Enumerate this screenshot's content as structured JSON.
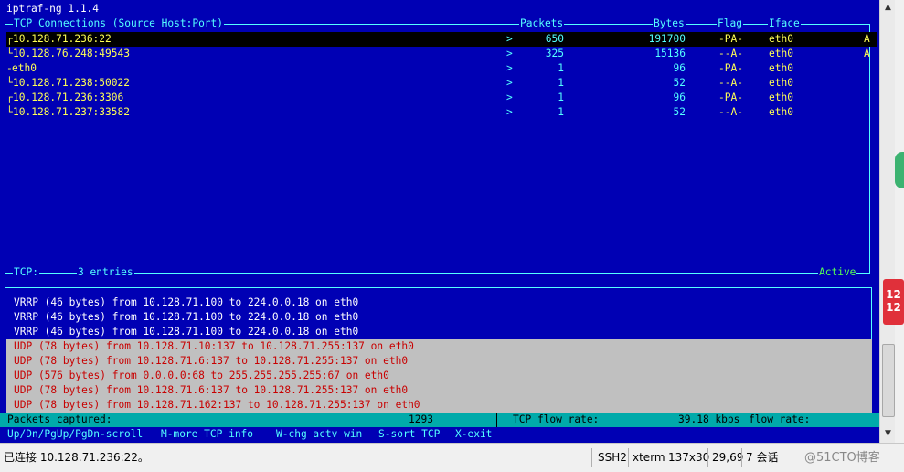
{
  "app": {
    "title": "iptraf-ng 1.1.4"
  },
  "tcp_panel": {
    "header": {
      "conn": "TCP Connections (Source Host:Port)",
      "packets": "Packets",
      "bytes": "Bytes",
      "flag": "Flag",
      "iface": "Iface"
    },
    "rows": [
      {
        "prefix": "┌",
        "host": "10.128.71.236:22",
        "arrow": ">",
        "packets": "650",
        "bytes": "191700",
        "flag": "-PA-",
        "iface": "eth0",
        "state": "A",
        "selected": true
      },
      {
        "prefix": "└",
        "host": "10.128.76.248:49543",
        "arrow": ">",
        "packets": "325",
        "bytes": "15136",
        "flag": "--A-",
        "iface": "eth0",
        "state": "A",
        "selected": false
      },
      {
        "prefix": "-",
        "host": "eth0",
        "arrow": ">",
        "packets": "1",
        "bytes": "96",
        "flag": "-PA-",
        "iface": "eth0",
        "state": "",
        "selected": false
      },
      {
        "prefix": "└",
        "host": "10.128.71.238:50022",
        "arrow": ">",
        "packets": "1",
        "bytes": "52",
        "flag": "--A-",
        "iface": "eth0",
        "state": "",
        "selected": false
      },
      {
        "prefix": "┌",
        "host": "10.128.71.236:3306",
        "arrow": ">",
        "packets": "1",
        "bytes": "96",
        "flag": "-PA-",
        "iface": "eth0",
        "state": "",
        "selected": false
      },
      {
        "prefix": "└",
        "host": "10.128.71.237:33582",
        "arrow": ">",
        "packets": "1",
        "bytes": "52",
        "flag": "--A-",
        "iface": "eth0",
        "state": "",
        "selected": false
      }
    ],
    "footer": {
      "label": "TCP:",
      "entries": "3 entries",
      "status": "Active"
    }
  },
  "log": {
    "lines": [
      {
        "text": "VRRP (46 bytes) from 10.128.71.100 to 224.0.0.18 on eth0",
        "style": "white"
      },
      {
        "text": "VRRP (46 bytes) from 10.128.71.100 to 224.0.0.18 on eth0",
        "style": "white"
      },
      {
        "text": "VRRP (46 bytes) from 10.128.71.100 to 224.0.0.18 on eth0",
        "style": "white"
      },
      {
        "text": "UDP (78 bytes) from 10.128.71.10:137 to 10.128.71.255:137 on eth0",
        "style": "red"
      },
      {
        "text": "UDP (78 bytes) from 10.128.71.6:137 to 10.128.71.255:137 on eth0",
        "style": "red"
      },
      {
        "text": "UDP (576 bytes) from 0.0.0.0:68 to 255.255.255.255:67 on eth0",
        "style": "red"
      },
      {
        "text": "UDP (78 bytes) from 10.128.71.6:137 to 10.128.71.255:137 on eth0",
        "style": "red"
      },
      {
        "text": "UDP (78 bytes) from 10.128.71.162:137 to 10.128.71.255:137 on eth0",
        "style": "red"
      }
    ]
  },
  "status": {
    "packets_label": "Packets captured:",
    "packets_value": "1293",
    "tcp_flow_label": "TCP flow rate:",
    "tcp_flow_value": "39.18 kbps",
    "flow_rate_label": "flow rate:"
  },
  "help": {
    "scroll": "Up/Dn/PgUp/PgDn-scroll",
    "more": "M-more TCP info",
    "chg": "W-chg actv win",
    "sort": "S-sort TCP",
    "exit": "X-exit"
  },
  "bottom_bar": {
    "connection": "已连接 10.128.71.236:22。",
    "protocol": "SSH2",
    "terminal": "xterm",
    "size": "137x30",
    "cursor": "29,69",
    "sessions": "7 会话",
    "watermark": "@51CTO博客"
  },
  "badge": {
    "text": "12\n12"
  },
  "colors": {
    "terminal_bg": "#0000b4",
    "yellow": "#ffff55",
    "cyan": "#55ffff",
    "green": "#55ff55",
    "red": "#c80000",
    "status_bg": "#00aaaa"
  }
}
